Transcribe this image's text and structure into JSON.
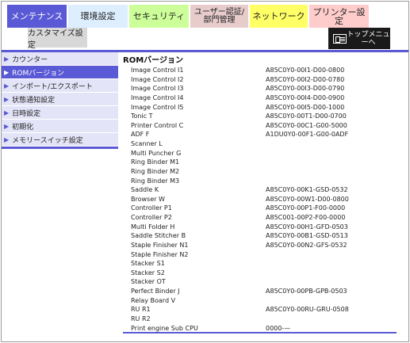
{
  "tabs": [
    {
      "label": "メンテナンス",
      "active": true
    },
    {
      "label": "環境設定"
    },
    {
      "label": "セキュリティ"
    },
    {
      "label": "ユーザー認証/部門管理"
    },
    {
      "label": "ネットワーク"
    },
    {
      "label": "プリンター設定"
    }
  ],
  "subtab": {
    "label": "カスタマイズ設定"
  },
  "top_menu": {
    "label": "トップメニューへ",
    "icon": "top-menu-icon"
  },
  "sidebar": {
    "items": [
      {
        "label": "カウンター"
      },
      {
        "label": "ROMバージョン",
        "active": true
      },
      {
        "label": "インポート/エクスポート"
      },
      {
        "label": "状態通知設定"
      },
      {
        "label": "日時設定"
      },
      {
        "label": "初期化"
      },
      {
        "label": "メモリースイッチ設定"
      }
    ]
  },
  "main": {
    "title": "ROMバージョン",
    "rows": [
      {
        "name": "Image Control I1",
        "value": "A85C0Y0-00I1-D00-0800"
      },
      {
        "name": "Image Control I2",
        "value": "A85C0Y0-00I2-D00-0780"
      },
      {
        "name": "Image Control I3",
        "value": "A85C0Y0-00I3-D00-0790"
      },
      {
        "name": "Image Control I4",
        "value": "A85C0Y0-00I4-D00-0900"
      },
      {
        "name": "Image Control I5",
        "value": "A85C0Y0-00I5-D00-1000"
      },
      {
        "name": "Tonic T",
        "value": "A85C0Y0-00T1-D00-0700"
      },
      {
        "name": "Printer Control C",
        "value": "A85C0Y0-00C1-G00-5000"
      },
      {
        "name": "ADF F",
        "value": "A1DU0Y0-00F1-G00-0ADF"
      },
      {
        "name": "Scanner L",
        "value": ""
      },
      {
        "name": "Multi Puncher G",
        "value": ""
      },
      {
        "name": "Ring Binder M1",
        "value": ""
      },
      {
        "name": "Ring Binder M2",
        "value": ""
      },
      {
        "name": "Ring Binder M3",
        "value": ""
      },
      {
        "name": "Saddle K",
        "value": "A85C0Y0-00K1-GSD-0532"
      },
      {
        "name": "Browser W",
        "value": "A85C0Y0-00W1-D00-0800"
      },
      {
        "name": "Controller P1",
        "value": "A85C0Y0-00P1-F00-0000"
      },
      {
        "name": "Controller P2",
        "value": "A85C001-00P2-F00-0000"
      },
      {
        "name": "Multi Folder H",
        "value": "A85C0Y0-00H1-GFD-0503"
      },
      {
        "name": "Saddle Stitcher B",
        "value": "A85C0Y0-00B1-GSD-0513"
      },
      {
        "name": "Staple Finisher N1",
        "value": "A85C0Y0-00N2-GFS-0532"
      },
      {
        "name": "Staple Finisher N2",
        "value": ""
      },
      {
        "name": "Stacker S1",
        "value": ""
      },
      {
        "name": "Stacker S2",
        "value": ""
      },
      {
        "name": "Stacker OT",
        "value": ""
      },
      {
        "name": "Perfect Binder J",
        "value": "A85C0Y0-00PB-GPB-0503"
      },
      {
        "name": "Relay Board V",
        "value": ""
      },
      {
        "name": "RU R1",
        "value": "A85C0Y0-00RU-GRU-0508"
      },
      {
        "name": "RU R2",
        "value": ""
      },
      {
        "name": "Print engine Sub CPU",
        "value": "0000-—"
      }
    ]
  },
  "colors": {
    "accent": "#5a5ad6",
    "sidebar_bg": "#e4e4f8",
    "tab_env": "#ddeeff",
    "tab_security": "#ccff99",
    "tab_user": "#e8cccc",
    "tab_network": "#ffff66",
    "tab_printer": "#ffcccc"
  }
}
